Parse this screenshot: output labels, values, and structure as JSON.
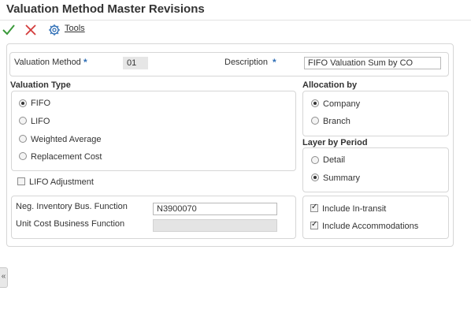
{
  "header": {
    "title": "Valuation Method Master Revisions"
  },
  "toolbar": {
    "ok_icon": "check-icon",
    "cancel_icon": "close-icon",
    "tools_label": "Tools"
  },
  "form": {
    "valuation_method": {
      "label": "Valuation Method",
      "value": "01"
    },
    "description": {
      "label": "Description",
      "value": "FIFO Valuation Sum by CO"
    }
  },
  "valuation_type": {
    "label": "Valuation Type",
    "options": [
      "FIFO",
      "LIFO",
      "Weighted Average",
      "Replacement Cost"
    ],
    "selected": "FIFO"
  },
  "lifo_adjustment": {
    "label": "LIFO Adjustment",
    "checked": false
  },
  "functions": {
    "neg_inventory": {
      "label": "Neg. Inventory Bus. Function",
      "value": "N3900070"
    },
    "unit_cost": {
      "label": "Unit Cost Business Function",
      "value": ""
    }
  },
  "allocation_by": {
    "label": "Allocation by",
    "options": [
      "Company",
      "Branch"
    ],
    "selected": "Company"
  },
  "layer_by_period": {
    "label": "Layer by Period",
    "options": [
      "Detail",
      "Summary"
    ],
    "selected": "Summary"
  },
  "includes": {
    "in_transit": {
      "label": "Include In-transit",
      "checked": true
    },
    "accommodations": {
      "label": "Include Accommodations",
      "checked": true
    }
  },
  "side_tab": {
    "icon": "double-chevron-left-icon",
    "glyph": "«"
  },
  "colors": {
    "accent": "#2f6fb6",
    "ok": "#3b9a3b",
    "cancel": "#d33b3b"
  }
}
